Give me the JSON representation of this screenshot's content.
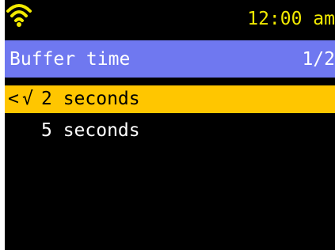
{
  "status": {
    "signal_icon": "wifi-icon",
    "time": "12:00 am"
  },
  "header": {
    "title": "Buffer time",
    "page": "1/2"
  },
  "menu": {
    "items": [
      {
        "marker": "<",
        "check": "√",
        "label": "2 seconds",
        "selected": true
      },
      {
        "marker": "",
        "check": "",
        "label": "5 seconds",
        "selected": false
      }
    ]
  },
  "colors": {
    "background": "#000000",
    "header_background": "#6f78f0",
    "selection_background": "#ffc600",
    "clock_text": "#f2ea00",
    "wifi_icon": "#f2ea00",
    "text": "#ffffff"
  }
}
